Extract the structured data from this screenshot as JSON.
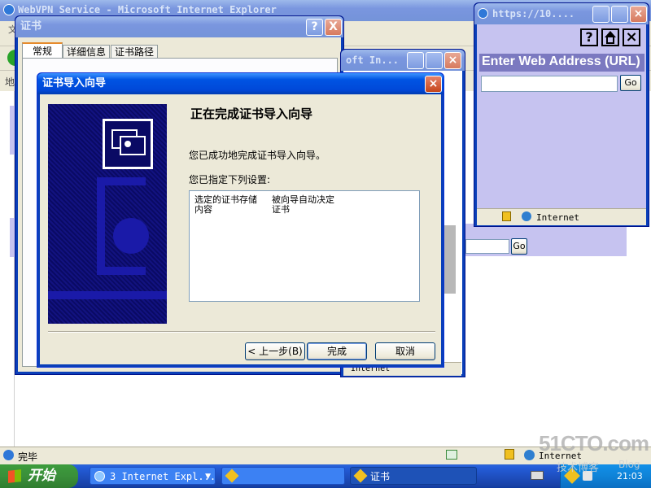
{
  "bg_ie": {
    "title": "WebVPN Service - Microsoft Internet Explorer",
    "menu_char": "文",
    "addr_char": "地",
    "status_text": "完毕",
    "zone_text": "Internet",
    "go_label": "Go"
  },
  "cert_window": {
    "title": "证书",
    "help": "?",
    "close": "X",
    "tabs": [
      "常规",
      "详细信息",
      "证书路径"
    ]
  },
  "mid_window": {
    "title": "oft In...",
    "zone_text": "Internet"
  },
  "wizard": {
    "title": "证书导入向导",
    "heading": "正在完成证书导入向导",
    "success_text": "您已成功地完成证书导入向导。",
    "settings_label": "您已指定下列设置:",
    "settings": [
      {
        "key": "选定的证书存储",
        "value": "被向导自动决定"
      },
      {
        "key": "内容",
        "value": "证书"
      }
    ],
    "back_label": "< 上一步(B)",
    "finish_label": "完成",
    "cancel_label": "取消"
  },
  "mini_browser": {
    "title": "https://10....",
    "header": "Enter Web Address (URL)",
    "go_label": "Go",
    "zone_text": "Internet"
  },
  "taskbar": {
    "start_label": "开始",
    "items": [
      "3 Internet Expl...",
      "",
      "证书"
    ],
    "clock": "21:03",
    "watermark_main": "51CTO.com",
    "watermark_sub": "技术博客",
    "watermark_blog": "Blog"
  },
  "colors": {
    "xp_blue": "#0054e3",
    "lavender": "#c6c3f0",
    "wizard_panel": "#0b0b6e"
  }
}
